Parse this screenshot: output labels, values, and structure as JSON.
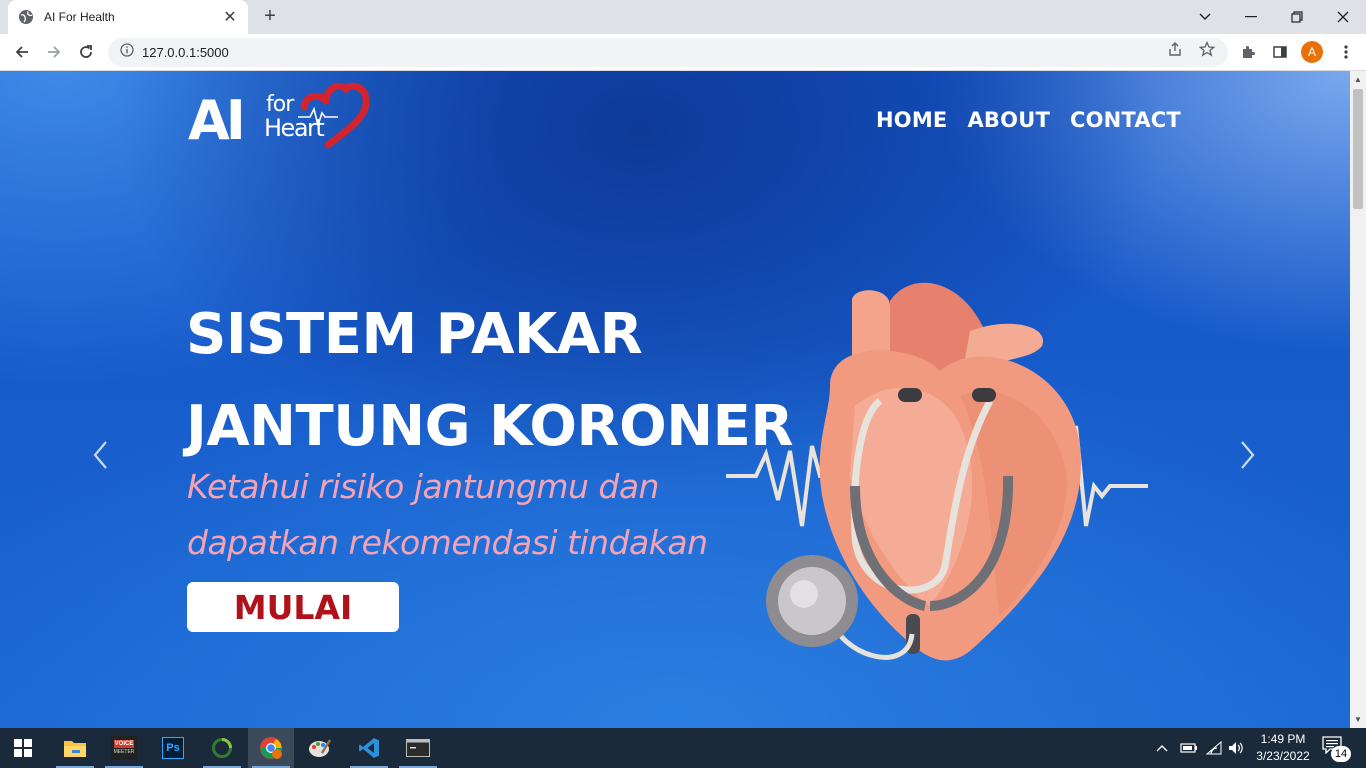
{
  "browser": {
    "tab_title": "AI For Health",
    "url": "127.0.0.1:5000",
    "profile_initial": "A"
  },
  "site": {
    "logo": {
      "text_ai": "AI",
      "text_for": "for",
      "text_heart": "Heart"
    },
    "nav": [
      {
        "label": "HOME"
      },
      {
        "label": "ABOUT"
      },
      {
        "label": "CONTACT"
      }
    ],
    "hero": {
      "title_line1": "SISTEM PAKAR",
      "title_line2": "JANTUNG KORONER",
      "subtitle_line1": "Ketahui risiko jantungmu dan",
      "subtitle_line2": "dapatkan rekomendasi tindakan",
      "cta_label": "MULAI"
    },
    "colors": {
      "hero_bg": "#1553c4",
      "subtitle": "#f4a3b5",
      "cta_text": "#b0111a",
      "logo_heart": "#d3232e"
    }
  },
  "taskbar": {
    "apps": [
      "start-icon",
      "file-explorer-icon",
      "voicemeeter-icon",
      "photoshop-icon",
      "progress-app-icon",
      "chrome-icon",
      "paint-icon",
      "vscode-icon",
      "terminal-icon"
    ],
    "voicemeeter_label": "VOICE",
    "voicemeeter_sub": "MEETER",
    "photoshop_label": "Ps",
    "time": "1:49 PM",
    "date": "3/23/2022",
    "notifications": "14"
  }
}
